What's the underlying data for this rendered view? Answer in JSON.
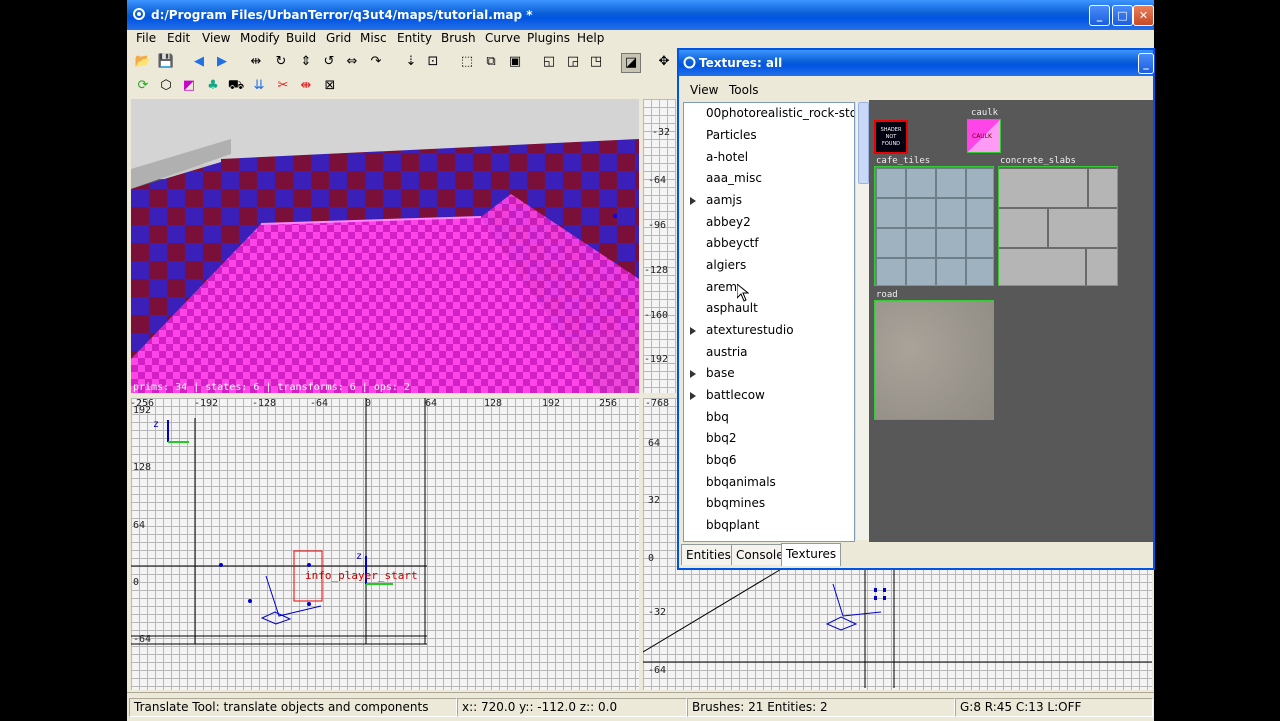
{
  "window": {
    "title": "d:/Program Files/UrbanTerror/q3ut4/maps/tutorial.map *"
  },
  "menu": [
    "File",
    "Edit",
    "View",
    "Modify",
    "Build",
    "Grid",
    "Misc",
    "Entity",
    "Brush",
    "Curve",
    "Plugins",
    "Help"
  ],
  "cam_view": {
    "overlay": "prims: 34 | states: 6 | transforms: 6 | ops: 2"
  },
  "xy_view": {
    "top_ruler": [
      "-256",
      "-192",
      "-128",
      "-64",
      "0",
      "64",
      "128",
      "192",
      "256"
    ],
    "left_ruler": [
      "192",
      "128",
      "64",
      "0",
      "-64"
    ],
    "axis_label": "z",
    "entity_label": "info_player_start"
  },
  "side_view": {
    "top_ruler": [
      "-32",
      "-64",
      "-96",
      "-128",
      "-160",
      "-192"
    ],
    "ruler2_top": "-768",
    "left_ruler": [
      "64",
      "32",
      "0",
      "-32",
      "-64"
    ],
    "axis_label": "z"
  },
  "textures_window": {
    "title": "Textures: all",
    "menu": [
      "View",
      "Tools"
    ],
    "list": [
      {
        "label": "00photorealistic_rock-stone",
        "expandable": false
      },
      {
        "label": "Particles",
        "expandable": false
      },
      {
        "label": "a-hotel",
        "expandable": false
      },
      {
        "label": "aaa_misc",
        "expandable": false
      },
      {
        "label": "aamjs",
        "expandable": true
      },
      {
        "label": "abbey2",
        "expandable": false
      },
      {
        "label": "abbeyctf",
        "expandable": false
      },
      {
        "label": "algiers",
        "expandable": false
      },
      {
        "label": "arem",
        "expandable": false
      },
      {
        "label": "asphault",
        "expandable": false
      },
      {
        "label": "atexturestudio",
        "expandable": true
      },
      {
        "label": "austria",
        "expandable": false
      },
      {
        "label": "base",
        "expandable": true
      },
      {
        "label": "battlecow",
        "expandable": true
      },
      {
        "label": "bbq",
        "expandable": false
      },
      {
        "label": "bbq2",
        "expandable": false
      },
      {
        "label": "bbq6",
        "expandable": false
      },
      {
        "label": "bbqanimals",
        "expandable": false
      },
      {
        "label": "bbqmines",
        "expandable": false
      },
      {
        "label": "bbqplant",
        "expandable": false
      }
    ],
    "shaders": {
      "notfound": "SHADER NOT FOUND",
      "caulk": "caulk",
      "caulk_tile_text": "CAULK",
      "cafe_tiles": "cafe_tiles",
      "concrete_slabs": "concrete_slabs",
      "road": "road"
    },
    "tabs": [
      "Entities",
      "Console",
      "Textures"
    ],
    "active_tab": "Textures"
  },
  "status": {
    "message": "Translate Tool: translate objects and components",
    "coords": "x::  720.0  y::  -112.0  z::     0.0",
    "counts": "Brushes: 21 Entities: 2",
    "grid": "G:8  R:45  C:13  L:OFF"
  },
  "colors": {
    "accent": "#0054e3",
    "magenta": "#ff33dd",
    "selection": "#22aa22"
  }
}
